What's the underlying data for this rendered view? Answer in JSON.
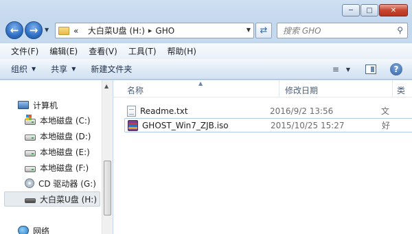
{
  "window": {
    "caption": {
      "minimize": "─",
      "maximize": "□",
      "close": "✕"
    }
  },
  "nav": {
    "back_icon": "arrow-left-icon",
    "forward_icon": "arrow-right-icon",
    "address": {
      "prefix": "«",
      "crumbs": [
        "大白菜U盘 (H:)",
        "GHO"
      ]
    },
    "search_placeholder": "搜索 GHO"
  },
  "menubar": {
    "items": [
      "文件(F)",
      "编辑(E)",
      "查看(V)",
      "工具(T)",
      "帮助(H)"
    ]
  },
  "toolbar": {
    "organize": "组织",
    "share": "共享",
    "new_folder": "新建文件夹"
  },
  "navpane": {
    "computer": "计算机",
    "drives": [
      "本地磁盘 (C:)",
      "本地磁盘 (D:)",
      "本地磁盘 (E:)",
      "本地磁盘 (F:)",
      "CD 驱动器 (G:)",
      "大白菜U盘 (H:)"
    ],
    "network": "网络"
  },
  "content": {
    "columns": {
      "name": "名称",
      "date": "修改日期",
      "type": "类"
    },
    "files": [
      {
        "name": "Readme.txt",
        "date": "2016/9/2 13:56",
        "type": "文"
      },
      {
        "name": "GHOST_Win7_ZJB.iso",
        "date": "2015/10/25 15:27",
        "type": "好"
      }
    ]
  }
}
